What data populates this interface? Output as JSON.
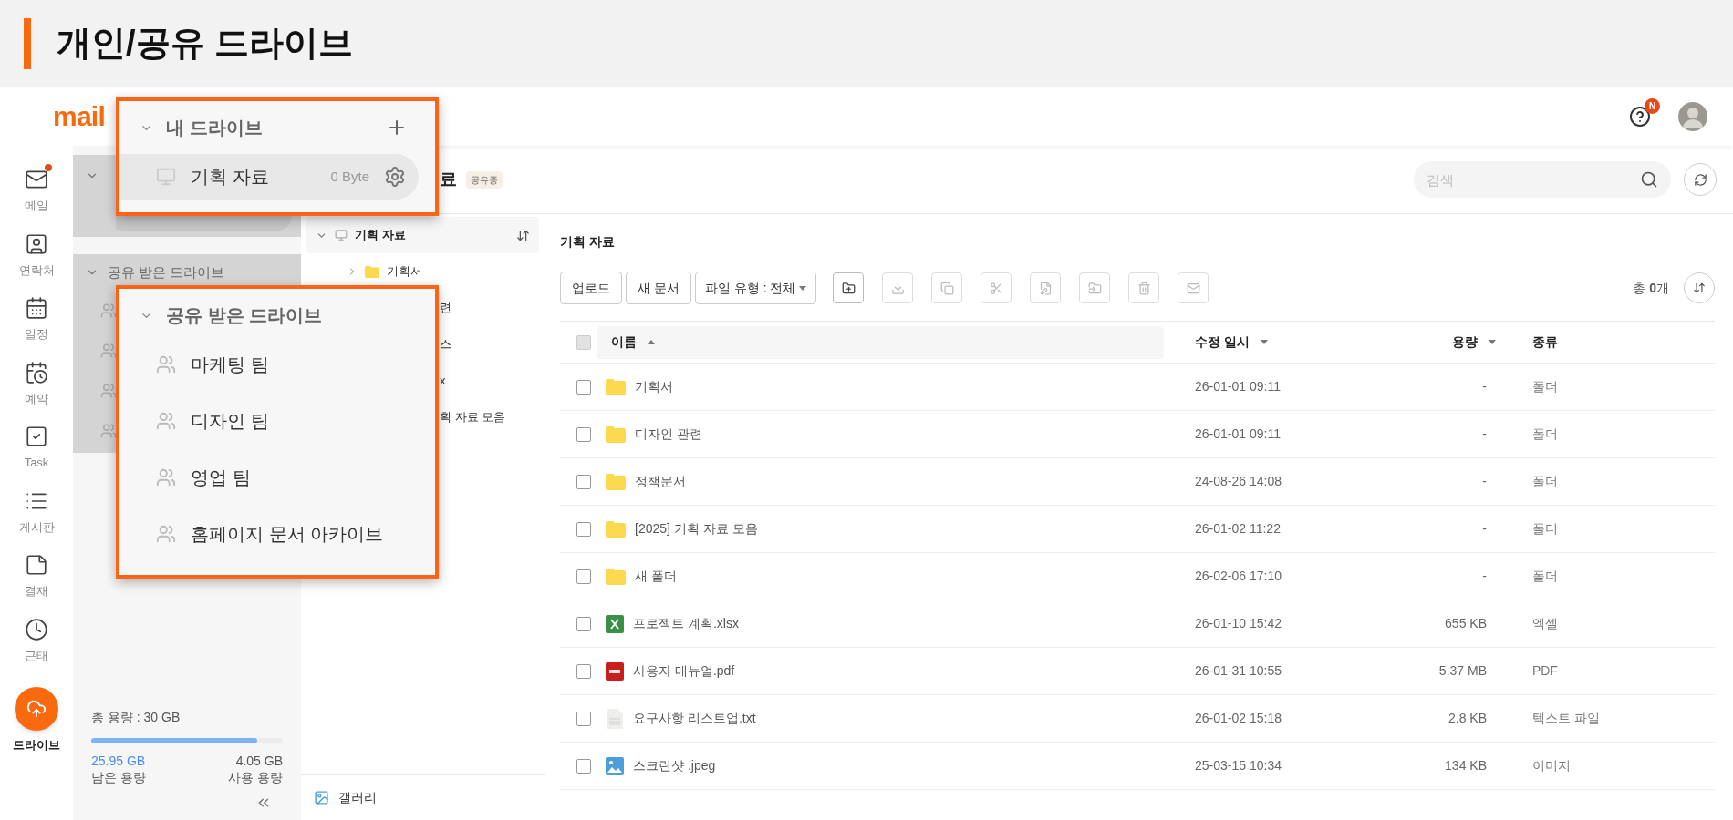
{
  "page_title": "개인/공유 드라이브",
  "header": {
    "logo": "mail",
    "help_badge": "N"
  },
  "nav": [
    {
      "kind": "mail",
      "label": "메일",
      "selected": false,
      "unread": true
    },
    {
      "kind": "contacts",
      "label": "연락처",
      "selected": false
    },
    {
      "kind": "calendar",
      "label": "일정",
      "selected": false
    },
    {
      "kind": "booking",
      "label": "예약",
      "selected": false
    },
    {
      "kind": "task",
      "label": "Task",
      "selected": false
    },
    {
      "kind": "board",
      "label": "게시판",
      "selected": false
    },
    {
      "kind": "approval",
      "label": "결재",
      "selected": false
    },
    {
      "kind": "attendance",
      "label": "근태",
      "selected": false
    },
    {
      "kind": "drive",
      "label": "드라이브",
      "selected": true
    }
  ],
  "sidebar": {
    "shared_header": "공유 받은 드라이브",
    "storage": {
      "total": "총 용량 : 30 GB",
      "level": 0.865,
      "remaining": "25.95 GB",
      "remaining_label": "남은 용량",
      "used": "4.05 GB",
      "used_label": "사용 용량"
    }
  },
  "main_header": {
    "title_fragment": "료",
    "badge": "공유중",
    "search": {
      "placeholder": "검색"
    }
  },
  "tree": {
    "root": "기획 자료",
    "expanded": true,
    "items": [
      {
        "text": "기획서",
        "kind": "folder"
      },
      {
        "text": "련",
        "kind": "fragment"
      },
      {
        "text": "스",
        "kind": "fragment"
      },
      {
        "text": "x",
        "kind": "fragment"
      },
      {
        "text": "획 자료 모음",
        "kind": "fragment"
      }
    ],
    "gallery": "갤러리"
  },
  "content": {
    "title": "기획 자료",
    "buttons": [
      "업로드",
      "새 문서"
    ],
    "filter": "파일 유형 : 전체",
    "total": "총 **0**개",
    "select_all": {
      "disabled": true
    },
    "columns": [
      {
        "label": "이름",
        "kind": "asc"
      },
      {
        "label": "수정 일시",
        "kind": "desc"
      },
      {
        "label": "용량",
        "kind": "desc"
      },
      {
        "label": "종류",
        "kind": "plain"
      }
    ],
    "rows": [
      {
        "kind": "folder",
        "name": "기획서",
        "modified": "26-01-01 09:11",
        "size": "-",
        "type": "폴더",
        "checked": false
      },
      {
        "kind": "folder",
        "name": "디자인 관련",
        "modified": "26-01-01 09:11",
        "size": "-",
        "type": "폴더",
        "checked": false
      },
      {
        "kind": "folder",
        "name": "정책문서",
        "modified": "24-08-26 14:08",
        "size": "-",
        "type": "폴더",
        "checked": false
      },
      {
        "kind": "folder",
        "name": "[2025] 기획 자료 모음",
        "modified": "26-01-02 11:22",
        "size": "-",
        "type": "폴더",
        "checked": false
      },
      {
        "kind": "folder",
        "name": "새 폴더",
        "modified": "26-02-06 17:10",
        "size": "-",
        "type": "폴더",
        "checked": false
      },
      {
        "kind": "excel",
        "name": "프로젝트 계획.xlsx",
        "modified": "26-01-10 15:42",
        "size": "655 KB",
        "type": "엑셀",
        "checked": false
      },
      {
        "kind": "pdf",
        "name": "사용자 매뉴얼.pdf",
        "modified": "26-01-31 10:55",
        "size": "5.37 MB",
        "type": "PDF",
        "checked": false
      },
      {
        "kind": "text",
        "name": "요구사항 리스트업.txt",
        "modified": "26-01-02 15:18",
        "size": "2.8 KB",
        "type": "텍스트 파일",
        "checked": false
      },
      {
        "kind": "image",
        "name": "스크린샷 .jpeg",
        "modified": "25-03-15 10:34",
        "size": "134 KB",
        "type": "이미지",
        "checked": false
      }
    ]
  },
  "callouts": [
    {
      "header": "내 드라이브",
      "expanded": true,
      "items": [
        {
          "name": "기획 자료",
          "size": "0 Byte",
          "selected": true
        }
      ]
    },
    {
      "header": "공유 받은 드라이브",
      "expanded": true,
      "items": [
        {
          "name": "마케팅 팀",
          "selected": false
        },
        {
          "name": "디자인 팀",
          "selected": false
        },
        {
          "name": "영업 팀",
          "selected": false
        },
        {
          "name": "홈페이지 문서 아카이브",
          "selected": false
        }
      ]
    }
  ]
}
